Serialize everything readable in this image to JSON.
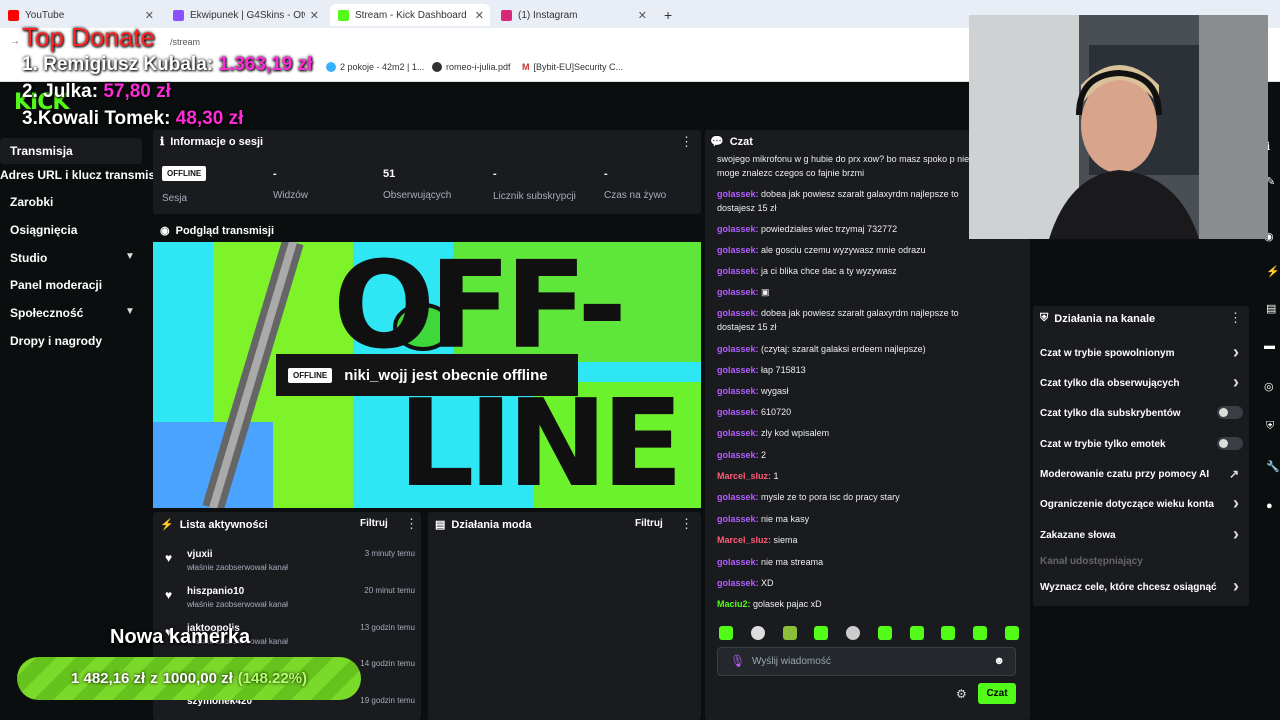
{
  "browser": {
    "tabs": [
      {
        "label": "YouTube",
        "color": "#ff0000",
        "active": false
      },
      {
        "label": "Ekwipunek | G4Skins - Otwiera",
        "color": "#8a4fff",
        "active": false
      },
      {
        "label": "Stream - Kick Dashboard",
        "color": "#53fc18",
        "active": true
      },
      {
        "label": "(1) Instagram",
        "color": "#d62976",
        "active": false
      }
    ],
    "url_partial": "/stream",
    "bookmarks": [
      "2 pokoje - 42m2 | 1...",
      "romeo-i-julia.pdf",
      "[Bybit-EU]Security C..."
    ]
  },
  "overlay": {
    "top_donate_title": "Top Donate",
    "donors": [
      {
        "rank_name": "1. Remigiusz Kubala:",
        "amount": "1.363,19 zł"
      },
      {
        "rank_name": "2. Julka:",
        "amount": "57,80 zł"
      },
      {
        "rank_name": "3.Kowali Tomek:",
        "amount": "48,30 zł"
      }
    ],
    "goal_title": "Nowa kamerka",
    "goal_current": "1 482,16 zł",
    "goal_mid": "z",
    "goal_target": "1000,00 zł",
    "goal_pct_label": "(148.22%)",
    "goal_progress": 1.0
  },
  "sidebar": {
    "logo": "KICK",
    "items": [
      "Transmisja",
      "Adres URL i klucz transmisji",
      "Zarobki",
      "Osiągnięcia",
      "Studio",
      "Panel moderacji",
      "Społeczność",
      "Dropy i nagrody"
    ]
  },
  "session": {
    "title": "Informacje o sesji",
    "badge": "OFFLINE",
    "stats": [
      {
        "value": "",
        "label": "Sesja"
      },
      {
        "value": "-",
        "label": "Widzów"
      },
      {
        "value": "51",
        "label": "Obserwujących"
      },
      {
        "value": "-",
        "label": "Licznik subskrypcji"
      },
      {
        "value": "-",
        "label": "Czas na żywo"
      }
    ]
  },
  "preview": {
    "title": "Podgląd transmisji",
    "badge": "OFFLINE",
    "message": "niki_wojj jest obecnie offline",
    "bg_text_top": "OFF-",
    "bg_text_bottom": "LINE"
  },
  "activity": {
    "title": "Lista aktywności",
    "filter": "Filtruj",
    "items": [
      {
        "name": "vjuxii",
        "sub": "właśnie zaobserwował kanał",
        "time": "3 minuty temu"
      },
      {
        "name": "hiszpanio10",
        "sub": "właśnie zaobserwował kanał",
        "time": "20 minut temu"
      },
      {
        "name": "jaktoopolis",
        "sub": "właśnie zaobserwował kanał",
        "time": "13 godzin temu"
      },
      {
        "name": "",
        "sub": "",
        "time": "14 godzin temu"
      },
      {
        "name": "szymonek420",
        "sub": "",
        "time": "19 godzin temu"
      }
    ]
  },
  "mod": {
    "title": "Działania moda",
    "filter": "Filtruj"
  },
  "chat": {
    "title": "Czat",
    "messages": [
      {
        "user": "",
        "color": "#fff",
        "text": "swojego mikrofonu w g hubie do prx xow? bo masz spoko p nie moge znalezc czegos co fajnie brzmi"
      },
      {
        "user": "golassek:",
        "color": "#b45cff",
        "text": "dobea jak powiesz szaralt galaxyrdm najlepsze to dostajesz 15 zł"
      },
      {
        "user": "golassek:",
        "color": "#b45cff",
        "text": "powiedziales wiec trzymaj 732772"
      },
      {
        "user": "golassek:",
        "color": "#b45cff",
        "text": "ale gosciu czemu wyzywasz mnie odrazu"
      },
      {
        "user": "golassek:",
        "color": "#b45cff",
        "text": "ja ci blika chce dac a ty wyzywasz"
      },
      {
        "user": "golassek:",
        "color": "#b45cff",
        "text": "▣"
      },
      {
        "user": "golassek:",
        "color": "#b45cff",
        "text": "dobea jak powiesz szaralt galaxyrdm najlepsze to dostajesz 15 zł"
      },
      {
        "user": "golassek:",
        "color": "#b45cff",
        "text": "(czytaj: szaralt galaksi erdeem najlepsze)"
      },
      {
        "user": "golassek:",
        "color": "#b45cff",
        "text": "łap 715813"
      },
      {
        "user": "golassek:",
        "color": "#b45cff",
        "text": "wygasł"
      },
      {
        "user": "golassek:",
        "color": "#b45cff",
        "text": "610720"
      },
      {
        "user": "golassek:",
        "color": "#b45cff",
        "text": "zly kod wpisalem"
      },
      {
        "user": "golassek:",
        "color": "#b45cff",
        "text": "2"
      },
      {
        "user": "Marcel_sluz:",
        "color": "#ff5c7a",
        "text": "1"
      },
      {
        "user": "golassek:",
        "color": "#b45cff",
        "text": "mysle ze to pora isc do pracy stary"
      },
      {
        "user": "golassek:",
        "color": "#b45cff",
        "text": "nie ma kasy"
      },
      {
        "user": "Marcel_sluz:",
        "color": "#ff5c7a",
        "text": "siema"
      },
      {
        "user": "golassek:",
        "color": "#b45cff",
        "text": "nie ma streama"
      },
      {
        "user": "golassek:",
        "color": "#b45cff",
        "text": "XD"
      },
      {
        "user": "Maciu2:",
        "color": "#53fc18",
        "text": "golasek pajac xD"
      }
    ],
    "input_placeholder": "Wyślij wiadomość",
    "send_label": "Czat"
  },
  "channel_actions": {
    "title": "Działania na kanale",
    "items": [
      {
        "label": "Czat w trybie spowolnionym",
        "control": "arrow"
      },
      {
        "label": "Czat tylko dla obserwujących",
        "control": "arrow"
      },
      {
        "label": "Czat tylko dla subskrybentów",
        "control": "toggle"
      },
      {
        "label": "Czat w trybie tylko emotek",
        "control": "toggle"
      },
      {
        "label": "Moderowanie czatu przy pomocy AI",
        "control": "external"
      },
      {
        "label": "Ograniczenie dotyczące wieku konta",
        "control": "arrow"
      },
      {
        "label": "Zakazane słowa",
        "control": "arrow"
      },
      {
        "label": "Kanał udostępniający",
        "control": "none"
      },
      {
        "label": "Wyznacz cele, które chcesz osiągnąć",
        "control": "arrow"
      }
    ]
  },
  "colors": {
    "kick_green": "#53fc18",
    "donate_pink": "#ff2bd6",
    "panel": "#191b1f"
  }
}
